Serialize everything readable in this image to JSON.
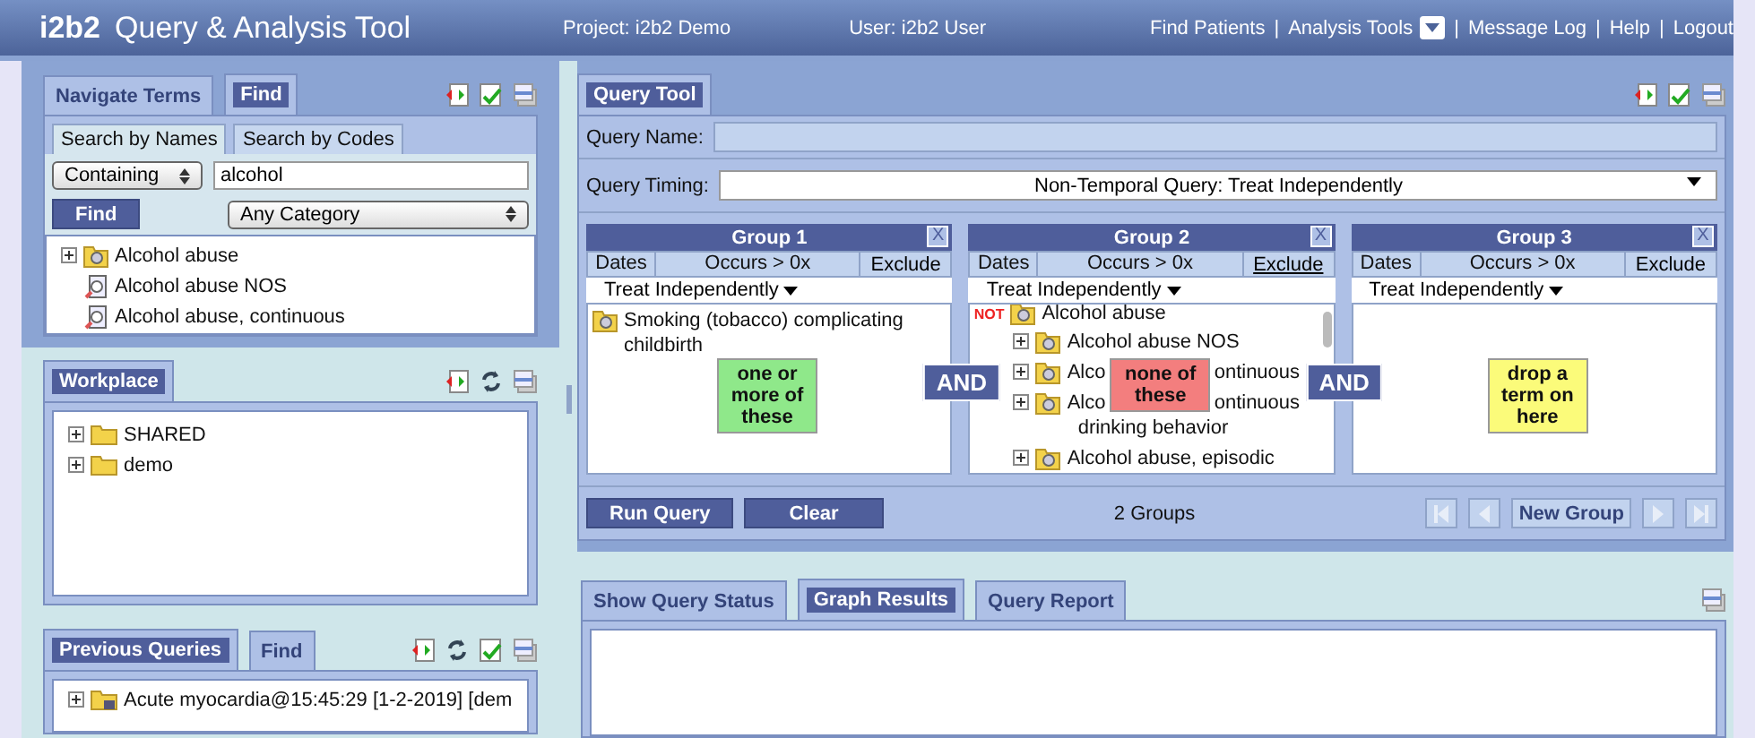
{
  "header": {
    "logo": "i2b2",
    "title": "Query & Analysis Tool",
    "project": "Project: i2b2 Demo",
    "user": "User: i2b2 User",
    "separator": "|",
    "menu": [
      {
        "label": "Find Patients",
        "kind": "link"
      },
      {
        "label": "Analysis Tools",
        "kind": "dropdown"
      },
      {
        "label": "Message Log",
        "kind": "link"
      },
      {
        "label": "Help",
        "kind": "link"
      },
      {
        "label": "Logout",
        "kind": "link"
      }
    ]
  },
  "terms_panel": {
    "tabs": [
      {
        "label": "Navigate Terms",
        "selected": false
      },
      {
        "label": "Find",
        "selected": true
      }
    ],
    "subtabs": [
      {
        "label": "Search by Names",
        "selected": true
      },
      {
        "label": "Search by Codes",
        "selected": false
      }
    ],
    "match": "Containing",
    "query": "alcohol",
    "find_button": "Find",
    "category": "Any Category",
    "results": [
      {
        "label": "Alcohol abuse",
        "kind": "folder"
      },
      {
        "label": "Alcohol abuse NOS",
        "kind": "leaf"
      },
      {
        "label": "Alcohol abuse, continuous",
        "kind": "leaf"
      }
    ]
  },
  "workplace": {
    "tabs": [
      {
        "label": "Workplace",
        "selected": true
      }
    ],
    "items": [
      {
        "label": "SHARED"
      },
      {
        "label": "demo"
      }
    ]
  },
  "previous_queries": {
    "tabs": [
      {
        "label": "Previous Queries",
        "selected": true
      },
      {
        "label": "Find",
        "selected": false
      }
    ],
    "items": [
      {
        "label": "Acute myocardia@15:45:29 [1-2-2019] [dem"
      }
    ]
  },
  "query_tool": {
    "tab": "Query Tool",
    "name_label": "Query Name:",
    "timing_label": "Query Timing:",
    "timing": "Non-Temporal Query: Treat Independently",
    "connectors": [
      "AND",
      "AND"
    ],
    "groups": [
      {
        "title": "Group 1",
        "close": "X",
        "dates": "Dates",
        "occurs": "Occurs > 0x",
        "exclude": "Exclude",
        "excluded": false,
        "mode": "Treat Independently",
        "hint": "one or more of these",
        "items": [
          {
            "label": "Smoking (tobacco) complicating childbirth",
            "kind": "plain"
          }
        ]
      },
      {
        "title": "Group 2",
        "close": "X",
        "dates": "Dates",
        "occurs": "Occurs > 0x",
        "exclude": "Exclude",
        "excluded": true,
        "mode": "Treat Independently",
        "hint": "none of these",
        "items": [
          {
            "label": "Alcohol abuse",
            "kind": "root",
            "prefix": "NOT"
          },
          {
            "label": "Alcohol abuse NOS",
            "kind": "child"
          },
          {
            "label": "Alco",
            "tail": "ontinuous",
            "kind": "covered"
          },
          {
            "label": "Alco",
            "tail": "ontinuous",
            "more": "drinking behavior",
            "kind": "covered"
          },
          {
            "label": "Alcohol abuse, episodic",
            "kind": "child"
          }
        ]
      },
      {
        "title": "Group 3",
        "close": "X",
        "dates": "Dates",
        "occurs": "Occurs > 0x",
        "exclude": "Exclude",
        "excluded": false,
        "mode": "Treat Independently",
        "hint": "drop a term on here"
      }
    ],
    "run_button": "Run Query",
    "clear_button": "Clear",
    "group_count": "2 Groups",
    "new_group_button": "New Group"
  },
  "results_panel": {
    "tabs": [
      {
        "label": "Show Query Status",
        "selected": false
      },
      {
        "label": "Graph Results",
        "selected": true
      },
      {
        "label": "Query Report",
        "selected": false
      }
    ]
  }
}
